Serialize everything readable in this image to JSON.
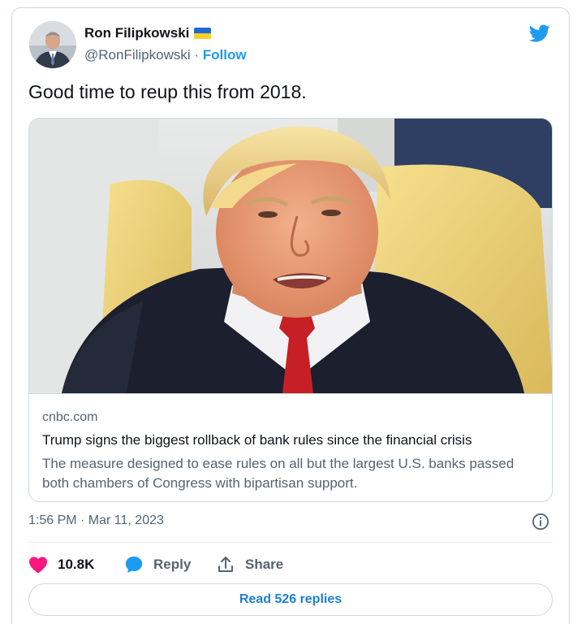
{
  "author": {
    "display_name": "Ron Filipkowski",
    "handle": "@RonFilipkowski",
    "separator": " · ",
    "follow_label": "Follow"
  },
  "tweet": {
    "text": "Good time to reup this from 2018.",
    "timestamp": "1:56 PM · Mar 11, 2023"
  },
  "link_card": {
    "domain": "cnbc.com",
    "title": "Trump signs the biggest rollback of bank rules since the financial crisis",
    "description": "The measure designed to ease rules on all but the largest U.S. banks passed both chambers of Congress with bipartisan support."
  },
  "actions": {
    "like_count": "10.8K",
    "reply_label": "Reply",
    "share_label": "Share",
    "read_replies_label": "Read 526 replies"
  },
  "colors": {
    "accent": "#1d9bf0",
    "like": "#f91880",
    "muted_text": "#536471",
    "border": "#cfd9de"
  },
  "icons": [
    "user-avatar",
    "ukraine-flag",
    "twitter-bird-icon",
    "info-icon",
    "heart-icon",
    "reply-bubble-icon",
    "share-icon"
  ]
}
